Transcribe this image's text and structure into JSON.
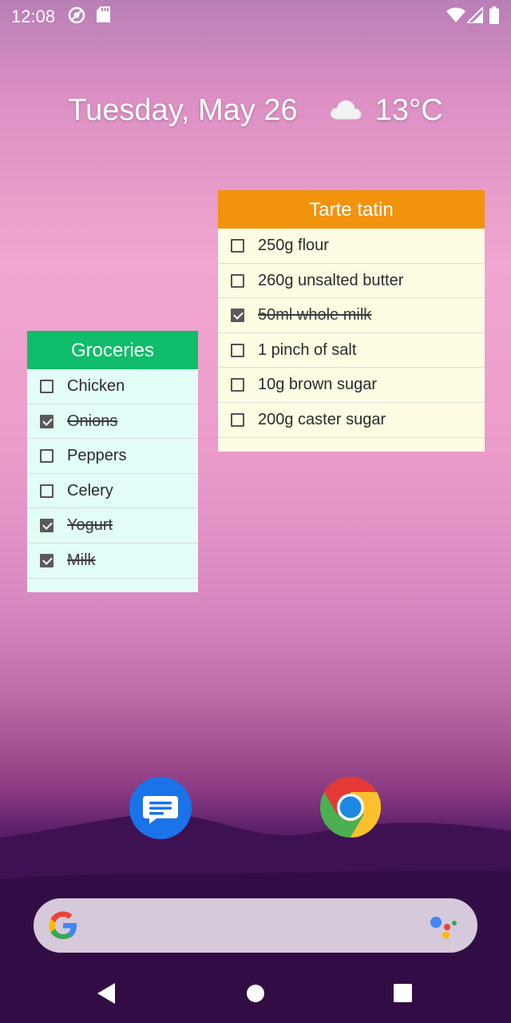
{
  "status_bar": {
    "time": "12:08",
    "icons": [
      "data-saver-icon",
      "sd-card-icon",
      "wifi-icon",
      "signal-icon",
      "battery-icon"
    ]
  },
  "at_a_glance": {
    "date": "Tuesday, May 26",
    "weather_icon": "cloud-icon",
    "temperature": "13°C"
  },
  "groceries_widget": {
    "title": "Groceries",
    "header_color": "#0fbd6b",
    "items": [
      {
        "label": "Chicken",
        "checked": false
      },
      {
        "label": "Onions",
        "checked": true
      },
      {
        "label": "Peppers",
        "checked": false
      },
      {
        "label": "Celery",
        "checked": false
      },
      {
        "label": "Yogurt",
        "checked": true
      },
      {
        "label": "Milk",
        "checked": true
      }
    ]
  },
  "tarte_widget": {
    "title": "Tarte tatin",
    "header_color": "#f2930d",
    "items": [
      {
        "label": "250g flour",
        "checked": false
      },
      {
        "label": "260g unsalted butter",
        "checked": false
      },
      {
        "label": "50ml whole milk",
        "checked": true
      },
      {
        "label": "1 pinch of salt",
        "checked": false
      },
      {
        "label": "10g brown sugar",
        "checked": false
      },
      {
        "label": "200g caster sugar",
        "checked": false
      }
    ]
  },
  "dock": {
    "apps": [
      {
        "name": "messages-app-icon"
      },
      {
        "name": "chrome-app-icon"
      }
    ]
  },
  "search_bar": {
    "logo": "google-logo-icon",
    "assistant": "google-assistant-icon"
  },
  "nav_bar": {
    "buttons": [
      "back-button",
      "home-button",
      "recents-button"
    ]
  }
}
